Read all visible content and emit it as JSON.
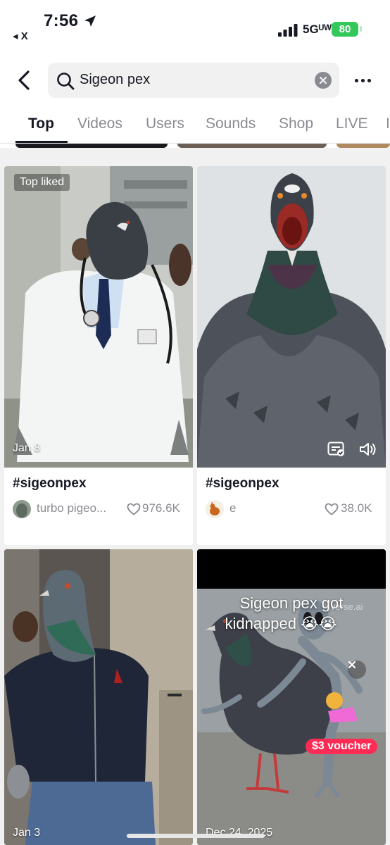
{
  "status_bar": {
    "time": "7:56",
    "back_app": "◂ X",
    "network": "5Gᵁᵂ",
    "battery": "80"
  },
  "search": {
    "query": "Sigeon pex"
  },
  "tabs": [
    "Top",
    "Videos",
    "Users",
    "Sounds",
    "Shop",
    "LIVE"
  ],
  "active_tab": "Top",
  "results": [
    {
      "badge": "Top liked",
      "date": "Jan 8",
      "title": "#sigeonpex",
      "author": "turbo pigeo...",
      "likes": "976.6K"
    },
    {
      "badge": "",
      "date": "",
      "title": "#sigeonpex",
      "author": "e",
      "likes": "38.0K"
    },
    {
      "badge": "",
      "date": "Jan 3",
      "title": "",
      "author": "",
      "likes": ""
    },
    {
      "badge": "",
      "date": "Dec 24, 2025",
      "caption_line1": "Sigeon pex got",
      "caption_line2": "kidnapped 😭😭",
      "watermark": "verse.ai",
      "voucher": "$3 voucher"
    }
  ],
  "colors": {
    "accent": "#fe2c55",
    "battery": "#34c759",
    "text_primary": "#161823",
    "text_secondary": "#8a8b91"
  }
}
